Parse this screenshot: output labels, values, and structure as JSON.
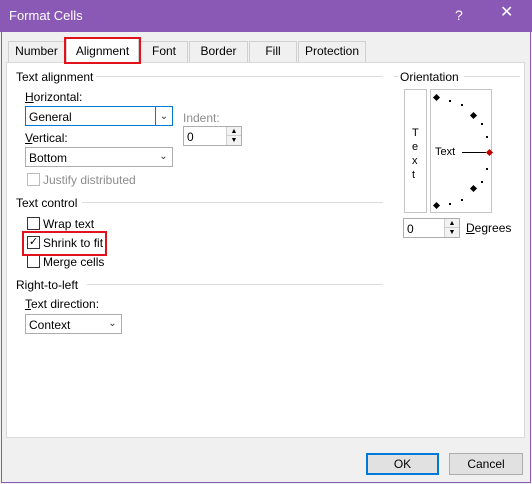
{
  "window": {
    "title": "Format Cells",
    "help_label": "?",
    "close_label": "✕"
  },
  "tabs": [
    {
      "label": "Number"
    },
    {
      "label": "Alignment",
      "active": true
    },
    {
      "label": "Font"
    },
    {
      "label": "Border"
    },
    {
      "label": "Fill"
    },
    {
      "label": "Protection"
    }
  ],
  "text_alignment": {
    "title": "Text alignment",
    "horizontal_label": "Horizontal:",
    "horizontal_value": "General",
    "indent_label": "Indent:",
    "indent_value": "0",
    "vertical_label": "Vertical:",
    "vertical_value": "Bottom",
    "justify_distributed_label": "Justify distributed"
  },
  "text_control": {
    "title": "Text control",
    "wrap_text_label": "Wrap text",
    "shrink_to_fit_label": "Shrink to fit",
    "merge_cells_label": "Merge cells"
  },
  "right_to_left": {
    "title": "Right-to-left",
    "text_direction_label": "Text direction:",
    "text_direction_value": "Context"
  },
  "orientation": {
    "title": "Orientation",
    "vertical_text": [
      "T",
      "e",
      "x",
      "t"
    ],
    "dial_text": "Text",
    "degrees_value": "0",
    "degrees_label": "Degrees"
  },
  "buttons": {
    "ok_label": "OK",
    "cancel_label": "Cancel"
  },
  "colors": {
    "title_bar": "#8a59b5",
    "highlight": "#e0121b",
    "focus": "#0078d7"
  }
}
